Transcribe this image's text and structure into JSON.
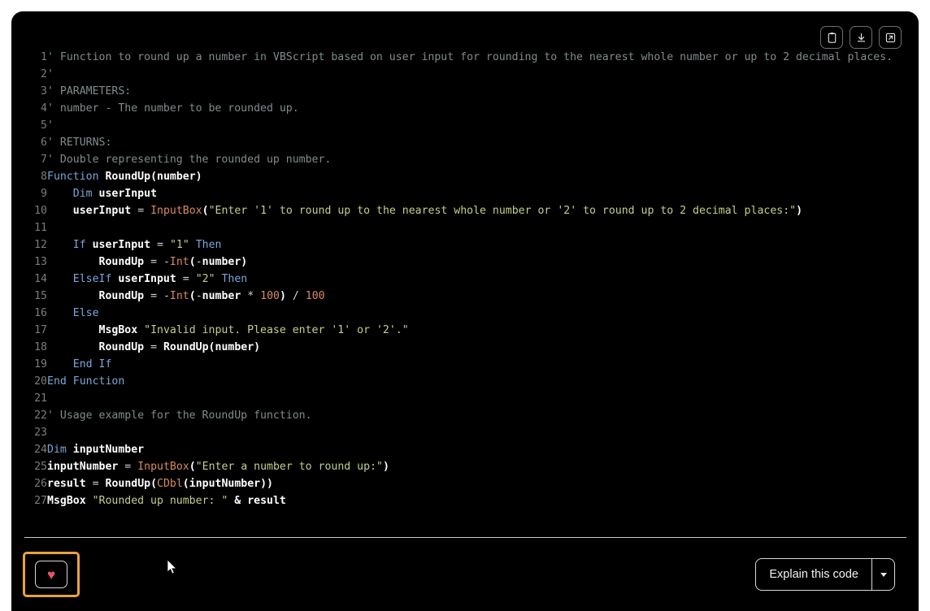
{
  "theme": {
    "page_background": "#ffffff",
    "card_background": "#000000",
    "text": "#d4d4d4",
    "line_number": "#7c7c7c",
    "comment": "#7f8c8d",
    "keyword": "#7aa6d6",
    "string": "#c3cf8a",
    "number": "#d98b5f",
    "builtin": "#d98b5f",
    "identifier": "#ffffff",
    "focus_ring": "#e8a33d",
    "heart": "#e8566a",
    "divider": "#c9c9c9"
  },
  "toolbar": {
    "buttons": [
      {
        "name": "copy-code-button",
        "icon": "clipboard-icon",
        "title": "Copy"
      },
      {
        "name": "download-code-button",
        "icon": "download-icon",
        "title": "Download"
      },
      {
        "name": "open-in-new-button",
        "icon": "external-link-icon",
        "title": "Open"
      }
    ]
  },
  "code": {
    "language": "VBScript",
    "first_line_number": 1,
    "line_count": 27,
    "lines": [
      {
        "n": 1,
        "tokens": [
          {
            "t": "' Function to round up a number in VBScript based on user input for rounding to the nearest whole number or up to 2 decimal places.",
            "c": "c-com"
          }
        ]
      },
      {
        "n": 2,
        "tokens": [
          {
            "t": "'",
            "c": "c-com"
          }
        ]
      },
      {
        "n": 3,
        "tokens": [
          {
            "t": "' PARAMETERS:",
            "c": "c-com"
          }
        ]
      },
      {
        "n": 4,
        "tokens": [
          {
            "t": "' number - The number to be rounded up.",
            "c": "c-com"
          }
        ]
      },
      {
        "n": 5,
        "tokens": [
          {
            "t": "'",
            "c": "c-com"
          }
        ]
      },
      {
        "n": 6,
        "tokens": [
          {
            "t": "' RETURNS:",
            "c": "c-com"
          }
        ]
      },
      {
        "n": 7,
        "tokens": [
          {
            "t": "' Double representing the rounded up number.",
            "c": "c-com"
          }
        ]
      },
      {
        "n": 8,
        "tokens": [
          {
            "t": "Function",
            "c": "c-kw"
          },
          {
            "t": " ",
            "c": "c-pl"
          },
          {
            "t": "RoundUp",
            "c": "c-fn"
          },
          {
            "t": "(",
            "c": "c-fn"
          },
          {
            "t": "number",
            "c": "c-fn"
          },
          {
            "t": ")",
            "c": "c-fn"
          }
        ]
      },
      {
        "n": 9,
        "tokens": [
          {
            "t": "    ",
            "c": "c-pl"
          },
          {
            "t": "Dim",
            "c": "c-kw"
          },
          {
            "t": " ",
            "c": "c-pl"
          },
          {
            "t": "userInput",
            "c": "c-id"
          }
        ]
      },
      {
        "n": 10,
        "tokens": [
          {
            "t": "    ",
            "c": "c-pl"
          },
          {
            "t": "userInput",
            "c": "c-id"
          },
          {
            "t": " ",
            "c": "c-pl"
          },
          {
            "t": "=",
            "c": "c-op"
          },
          {
            "t": " ",
            "c": "c-pl"
          },
          {
            "t": "InputBox",
            "c": "c-bi"
          },
          {
            "t": "(",
            "c": "c-fn"
          },
          {
            "t": "\"Enter '1' to round up to the nearest whole number or '2' to round up to 2 decimal places:\"",
            "c": "c-str"
          },
          {
            "t": ")",
            "c": "c-fn"
          }
        ]
      },
      {
        "n": 11,
        "tokens": [
          {
            "t": "",
            "c": "c-pl"
          }
        ]
      },
      {
        "n": 12,
        "tokens": [
          {
            "t": "    ",
            "c": "c-pl"
          },
          {
            "t": "If",
            "c": "c-kw"
          },
          {
            "t": " ",
            "c": "c-pl"
          },
          {
            "t": "userInput",
            "c": "c-id"
          },
          {
            "t": " ",
            "c": "c-pl"
          },
          {
            "t": "=",
            "c": "c-op"
          },
          {
            "t": " ",
            "c": "c-pl"
          },
          {
            "t": "\"1\"",
            "c": "c-str"
          },
          {
            "t": " ",
            "c": "c-pl"
          },
          {
            "t": "Then",
            "c": "c-kw"
          }
        ]
      },
      {
        "n": 13,
        "tokens": [
          {
            "t": "        ",
            "c": "c-pl"
          },
          {
            "t": "RoundUp",
            "c": "c-id"
          },
          {
            "t": " ",
            "c": "c-pl"
          },
          {
            "t": "=",
            "c": "c-op"
          },
          {
            "t": " ",
            "c": "c-pl"
          },
          {
            "t": "-",
            "c": "c-op"
          },
          {
            "t": "Int",
            "c": "c-bi"
          },
          {
            "t": "(",
            "c": "c-fn"
          },
          {
            "t": "-",
            "c": "c-op"
          },
          {
            "t": "number",
            "c": "c-id"
          },
          {
            "t": ")",
            "c": "c-fn"
          }
        ]
      },
      {
        "n": 14,
        "tokens": [
          {
            "t": "    ",
            "c": "c-pl"
          },
          {
            "t": "ElseIf",
            "c": "c-kw"
          },
          {
            "t": " ",
            "c": "c-pl"
          },
          {
            "t": "userInput",
            "c": "c-id"
          },
          {
            "t": " ",
            "c": "c-pl"
          },
          {
            "t": "=",
            "c": "c-op"
          },
          {
            "t": " ",
            "c": "c-pl"
          },
          {
            "t": "\"2\"",
            "c": "c-str"
          },
          {
            "t": " ",
            "c": "c-pl"
          },
          {
            "t": "Then",
            "c": "c-kw"
          }
        ]
      },
      {
        "n": 15,
        "tokens": [
          {
            "t": "        ",
            "c": "c-pl"
          },
          {
            "t": "RoundUp",
            "c": "c-id"
          },
          {
            "t": " ",
            "c": "c-pl"
          },
          {
            "t": "=",
            "c": "c-op"
          },
          {
            "t": " ",
            "c": "c-pl"
          },
          {
            "t": "-",
            "c": "c-op"
          },
          {
            "t": "Int",
            "c": "c-bi"
          },
          {
            "t": "(",
            "c": "c-fn"
          },
          {
            "t": "-",
            "c": "c-op"
          },
          {
            "t": "number",
            "c": "c-id"
          },
          {
            "t": " ",
            "c": "c-pl"
          },
          {
            "t": "*",
            "c": "c-op"
          },
          {
            "t": " ",
            "c": "c-pl"
          },
          {
            "t": "100",
            "c": "c-num"
          },
          {
            "t": ")",
            "c": "c-fn"
          },
          {
            "t": " ",
            "c": "c-pl"
          },
          {
            "t": "/",
            "c": "c-op"
          },
          {
            "t": " ",
            "c": "c-pl"
          },
          {
            "t": "100",
            "c": "c-num"
          }
        ]
      },
      {
        "n": 16,
        "tokens": [
          {
            "t": "    ",
            "c": "c-pl"
          },
          {
            "t": "Else",
            "c": "c-kw"
          }
        ]
      },
      {
        "n": 17,
        "tokens": [
          {
            "t": "        ",
            "c": "c-pl"
          },
          {
            "t": "MsgBox",
            "c": "c-id"
          },
          {
            "t": " ",
            "c": "c-pl"
          },
          {
            "t": "\"Invalid input. Please enter '1' or '2'.\"",
            "c": "c-str"
          }
        ]
      },
      {
        "n": 18,
        "tokens": [
          {
            "t": "        ",
            "c": "c-pl"
          },
          {
            "t": "RoundUp",
            "c": "c-id"
          },
          {
            "t": " ",
            "c": "c-pl"
          },
          {
            "t": "=",
            "c": "c-op"
          },
          {
            "t": " ",
            "c": "c-pl"
          },
          {
            "t": "RoundUp",
            "c": "c-id"
          },
          {
            "t": "(",
            "c": "c-fn"
          },
          {
            "t": "number",
            "c": "c-id"
          },
          {
            "t": ")",
            "c": "c-fn"
          }
        ]
      },
      {
        "n": 19,
        "tokens": [
          {
            "t": "    ",
            "c": "c-pl"
          },
          {
            "t": "End If",
            "c": "c-kw"
          }
        ]
      },
      {
        "n": 20,
        "tokens": [
          {
            "t": "End Function",
            "c": "c-kw"
          }
        ]
      },
      {
        "n": 21,
        "tokens": [
          {
            "t": "",
            "c": "c-pl"
          }
        ]
      },
      {
        "n": 22,
        "tokens": [
          {
            "t": "' Usage example for the RoundUp function.",
            "c": "c-com"
          }
        ]
      },
      {
        "n": 23,
        "tokens": [
          {
            "t": "",
            "c": "c-pl"
          }
        ]
      },
      {
        "n": 24,
        "tokens": [
          {
            "t": "Dim",
            "c": "c-kw"
          },
          {
            "t": " ",
            "c": "c-pl"
          },
          {
            "t": "inputNumber",
            "c": "c-id"
          }
        ]
      },
      {
        "n": 25,
        "tokens": [
          {
            "t": "inputNumber",
            "c": "c-id"
          },
          {
            "t": " ",
            "c": "c-pl"
          },
          {
            "t": "=",
            "c": "c-op"
          },
          {
            "t": " ",
            "c": "c-pl"
          },
          {
            "t": "InputBox",
            "c": "c-bi"
          },
          {
            "t": "(",
            "c": "c-fn"
          },
          {
            "t": "\"Enter a number to round up:\"",
            "c": "c-str"
          },
          {
            "t": ")",
            "c": "c-fn"
          }
        ]
      },
      {
        "n": 26,
        "tokens": [
          {
            "t": "result",
            "c": "c-id"
          },
          {
            "t": " ",
            "c": "c-pl"
          },
          {
            "t": "=",
            "c": "c-op"
          },
          {
            "t": " ",
            "c": "c-pl"
          },
          {
            "t": "RoundUp",
            "c": "c-id"
          },
          {
            "t": "(",
            "c": "c-fn"
          },
          {
            "t": "CDbl",
            "c": "c-bi"
          },
          {
            "t": "(",
            "c": "c-fn"
          },
          {
            "t": "inputNumber",
            "c": "c-id"
          },
          {
            "t": "))",
            "c": "c-fn"
          }
        ]
      },
      {
        "n": 27,
        "tokens": [
          {
            "t": "MsgBox",
            "c": "c-id"
          },
          {
            "t": " ",
            "c": "c-pl"
          },
          {
            "t": "\"Rounded up number: \"",
            "c": "c-str"
          },
          {
            "t": " ",
            "c": "c-pl"
          },
          {
            "t": "&",
            "c": "c-id"
          },
          {
            "t": " ",
            "c": "c-pl"
          },
          {
            "t": "result",
            "c": "c-id"
          }
        ]
      }
    ]
  },
  "footer": {
    "favorite": {
      "icon": "heart-icon",
      "glyph": "♥",
      "focused": true
    },
    "explain_label": "Explain this code",
    "caret_icon": "chevron-down-icon"
  }
}
